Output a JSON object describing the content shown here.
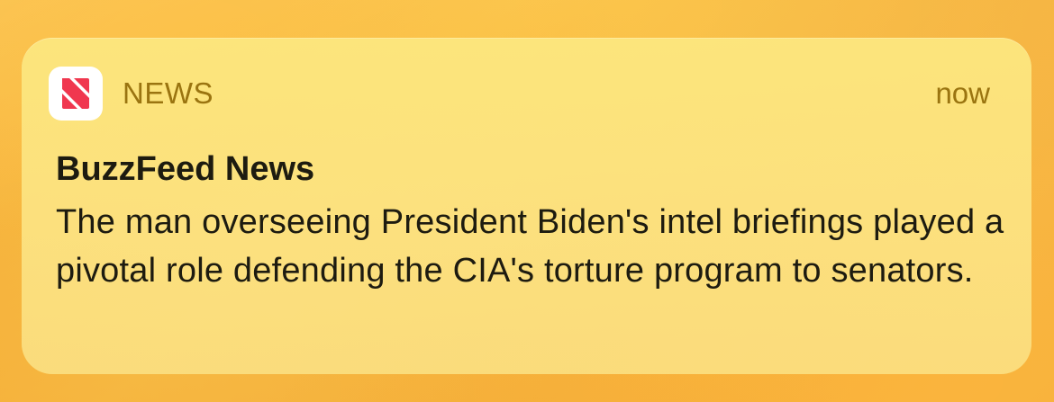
{
  "notification": {
    "app_name": "NEWS",
    "time": "now",
    "title": "BuzzFeed News",
    "body": "The man overseeing President Biden's intel briefings played a pivotal role defending the CIA's torture program to senators.",
    "icon": "apple-news-icon"
  },
  "colors": {
    "news_red": "#f0374f",
    "header_text": "#9a7410",
    "body_text": "#1d1b10"
  }
}
